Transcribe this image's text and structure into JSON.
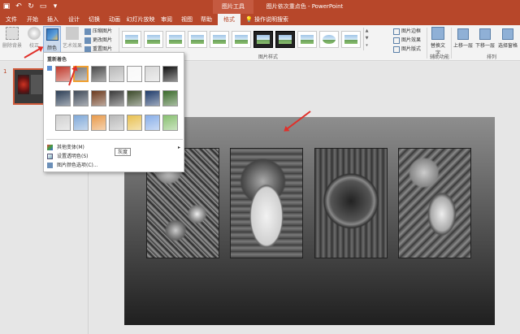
{
  "titlebar": {
    "doc_title": "图片依次重点色 - PowerPoint",
    "context_tab": "图片工具"
  },
  "tabs": [
    {
      "label": "文件"
    },
    {
      "label": "开始"
    },
    {
      "label": "插入"
    },
    {
      "label": "设计"
    },
    {
      "label": "切换"
    },
    {
      "label": "动画"
    },
    {
      "label": "幻灯片放映"
    },
    {
      "label": "审阅"
    },
    {
      "label": "视图"
    },
    {
      "label": "帮助"
    },
    {
      "label": "格式"
    }
  ],
  "tell_me": "操作说明搜索",
  "ribbon": {
    "remove_bg": "删除背景",
    "corrections": "校正",
    "color": "颜色",
    "artistic": "艺术效果",
    "compress": "压缩图片",
    "change_picture": "更改图片",
    "reset_picture": "重置图片",
    "picture_styles_group": "图片样式",
    "border": "图片边框",
    "effects": "图片效果",
    "layout": "图片版式",
    "alt_text": "替换文字",
    "accessibility_group": "辅助功能",
    "bring_forward": "上移一层",
    "send_backward": "下移一层",
    "selection_pane": "选择窗格",
    "arrange_group": "排列"
  },
  "slide_panel": {
    "slide_number": "1"
  },
  "recolor": {
    "title": "重新着色",
    "tooltip": "灰度",
    "more_variations": "其他变体(M)",
    "set_transparent": "设置透明色(S)",
    "color_options": "图片颜色选项(C)...",
    "swatches": [
      [
        "#c0392b",
        "#7a7a7a",
        "#4a4a4a",
        "#b8b8b8",
        "#f8f8f8",
        "#d8d8d8",
        "#101010"
      ],
      [
        "#2c3e55",
        "#404a58",
        "#6b3a1e",
        "#3a3a3a",
        "#3b4a2a",
        "#1f3b6a",
        "#3a6a2a"
      ],
      [
        "#d0d0d0",
        "#7fa8d8",
        "#e89a4a",
        "#b8b8b8",
        "#e8c050",
        "#88aee8",
        "#88c070"
      ]
    ]
  },
  "colors": {
    "accent": "#b7472a",
    "arrow": "#e0302a",
    "selected_swatch_border": "#f0a030"
  }
}
